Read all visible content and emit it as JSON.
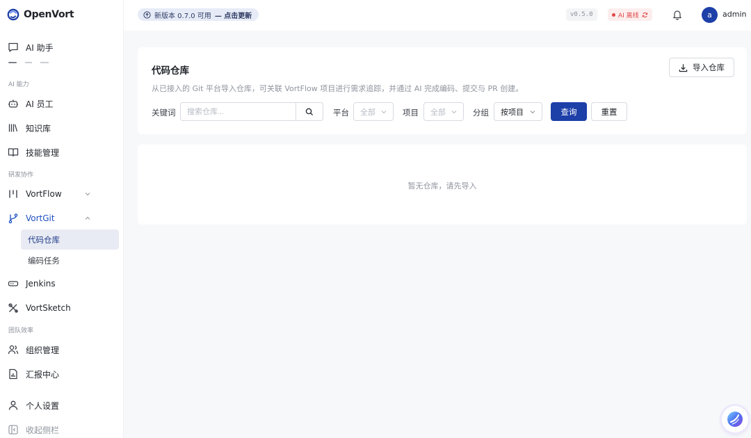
{
  "app": {
    "name": "OpenVort"
  },
  "header": {
    "update_text": "新版本 0.7.0 可用",
    "update_link": "— 点击更新",
    "version": "v0.5.0",
    "ai_status": "AI 离线",
    "user_initial": "a",
    "username": "admin"
  },
  "sidebar": {
    "ai_assistant": "AI 助手",
    "section_ai": "AI 能力",
    "ai_staff": "AI 员工",
    "knowledge": "知识库",
    "skills": "技能管理",
    "section_dev": "研发协作",
    "vortflow": "VortFlow",
    "vortgit": "VortGit",
    "sub_repos": "代码仓库",
    "sub_tasks": "编码任务",
    "jenkins": "Jenkins",
    "vortsketch": "VortSketch",
    "section_team": "团队效率",
    "org": "组织管理",
    "reports": "汇报中心",
    "personal": "个人设置",
    "collapse": "收起侧栏"
  },
  "page": {
    "title": "代码仓库",
    "description": "从已接入的 Git 平台导入仓库，可关联 VortFlow 项目进行需求追踪，并通过 AI 完成编码、提交与 PR 创建。",
    "import_button": "导入仓库"
  },
  "filters": {
    "keyword_label": "关键词",
    "search_placeholder": "搜索仓库...",
    "platform_label": "平台",
    "platform_value": "全部",
    "project_label": "项目",
    "project_value": "全部",
    "group_label": "分组",
    "group_value": "按项目",
    "query_button": "查询",
    "reset_button": "重置"
  },
  "empty": {
    "text": "暂无仓库，请先导入"
  },
  "colors": {
    "primary": "#1d3fa8",
    "danger": "#e04848",
    "active_bg": "#e8ebf3"
  }
}
